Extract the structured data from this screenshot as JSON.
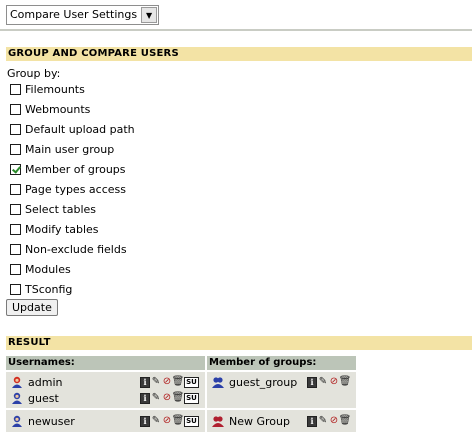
{
  "top": {
    "select_value": "Compare User Settings"
  },
  "group_section": {
    "title": "GROUP AND COMPARE USERS",
    "group_by_label": "Group by:",
    "options": [
      {
        "label": "Filemounts",
        "checked": false
      },
      {
        "label": "Webmounts",
        "checked": false
      },
      {
        "label": "Default upload path",
        "checked": false
      },
      {
        "label": "Main user group",
        "checked": false
      },
      {
        "label": "Member of groups",
        "checked": true
      },
      {
        "label": "Page types access",
        "checked": false
      },
      {
        "label": "Select tables",
        "checked": false
      },
      {
        "label": "Modify tables",
        "checked": false
      },
      {
        "label": "Non-exclude fields",
        "checked": false
      },
      {
        "label": "Modules",
        "checked": false
      },
      {
        "label": "TSconfig",
        "checked": false
      }
    ],
    "update_button": "Update"
  },
  "result_section": {
    "title": "RESULT",
    "columns": [
      "Usernames:",
      "Member of groups:"
    ],
    "rows": [
      {
        "users": [
          {
            "name": "admin",
            "icon": "admin-user-icon"
          },
          {
            "name": "guest",
            "icon": "user-icon"
          }
        ],
        "group": "guest_group"
      },
      {
        "users": [
          {
            "name": "newuser",
            "icon": "user-icon"
          }
        ],
        "group": "New Group"
      }
    ],
    "action_icons": [
      "info-icon",
      "edit-icon",
      "hide-icon",
      "delete-icon",
      "switch-user-icon"
    ],
    "su_label": "SU"
  }
}
